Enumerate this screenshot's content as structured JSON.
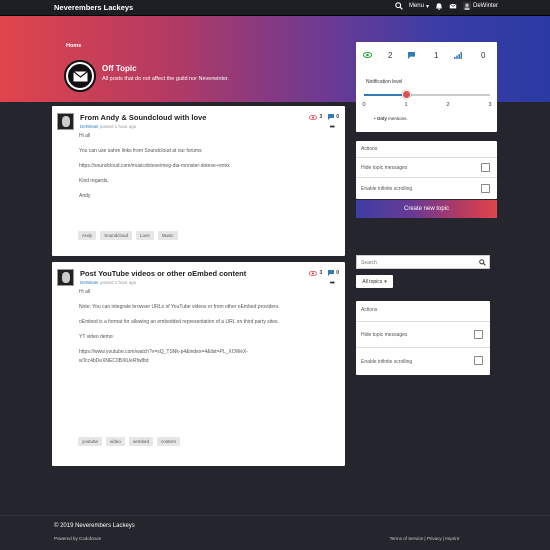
{
  "navbar": {
    "brand": "Neverembers Lackeys",
    "menu_label": "Menu",
    "username": "DeWinter"
  },
  "category": {
    "breadcrumb": "Home",
    "title": "Off Topic",
    "description": "All posts that do not affect the guild nor Neverwinter."
  },
  "posts": [
    {
      "title": "From Andy & Soundcloud with love",
      "author": "DeWinter",
      "meta": "posted 1 hour ago",
      "views": "3",
      "comments": "0",
      "body": [
        "Hi all",
        "You can use sahre links from Soundcloud at our forums",
        "https://soundcloud.com/musicdotexe/meg-dia-monster-dotexe-remix",
        "Kind regards,",
        "Andy"
      ],
      "tags": [
        "Andy",
        "Soundcloud",
        "Love",
        "Music"
      ]
    },
    {
      "title": "Post YouTube videos or other oEmbed content",
      "author": "DeWinter",
      "meta": "posted 1 hour ago",
      "views": "3",
      "comments": "0",
      "body": [
        "Hi all",
        "Note: You can integrate browser URLs of YouTube videos or from other oEmbed providers.",
        "oEmbed is a format for allowing an embedded representation of a URL on third party sites.",
        "YT video demo:",
        "https://www.youtube.com/watch?v=sQ_TSNk-p4&index=4&list=PL_XOWeX-",
        "wTcc4bDeXNEC0BXlUeRfw8td"
      ],
      "tags": [
        "youtube",
        "video",
        "oembed",
        "content"
      ]
    }
  ],
  "notifications": {
    "counts": [
      "2",
      "1",
      "0"
    ],
    "label": "Notification level",
    "ticks": [
      "0",
      "1",
      "2",
      "3"
    ],
    "level": 1,
    "max": 3,
    "note_bold": "Only",
    "note_rest": "mentions."
  },
  "actions": {
    "title": "Actions",
    "hide_label": "Hide topic messages",
    "scroll_label": "Enable infinite scrolling"
  },
  "create_topic_label": "Create new topic",
  "search": {
    "placeholder": "Search"
  },
  "topics_filter": "All topics",
  "footer": {
    "copyright": "© 2019 Neverembers Lackeys",
    "powered": "Powered by Codoforum",
    "links": "Terms of Service | Privacy | Imprint"
  },
  "colors": {
    "accent_blue": "#337ab7",
    "accent_red": "#e14c4c",
    "background": "#24252d"
  }
}
